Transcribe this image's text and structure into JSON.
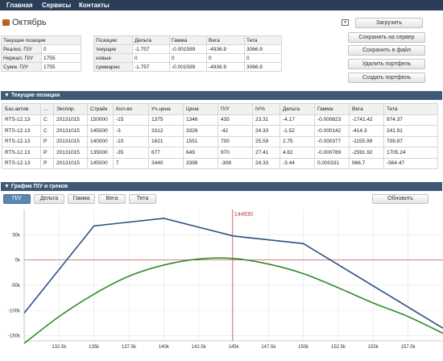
{
  "nav": {
    "items": [
      "Главная",
      "Сервисы",
      "Контакты"
    ]
  },
  "portfolio": {
    "name": "Октябрь"
  },
  "summary": {
    "header": "Текущие позиции",
    "rows": [
      {
        "label": "Реализ. П/У",
        "value": "0"
      },
      {
        "label": "Нереал. П/У",
        "value": "1755"
      },
      {
        "label": "Сумм. П/У",
        "value": "1755"
      }
    ]
  },
  "greeks": {
    "header": [
      "Позиции:",
      "Дельта",
      "Гамма",
      "Вега",
      "Тета"
    ],
    "rows": [
      [
        "текущие",
        "-1.757",
        "-0.001599",
        "-4936.9",
        "3066.9"
      ],
      [
        "новые",
        "0",
        "0",
        "0",
        "0"
      ],
      [
        "суммарно",
        "-1.757",
        "-0.001599",
        "-4936.9",
        "3066.9"
      ]
    ]
  },
  "buttons": {
    "dropdown": "▾",
    "load": "Загрузить",
    "save_server": "Сохранить на сервер",
    "save_file": "Сохранить в файл",
    "delete": "Удалить портфель",
    "create": "Создать портфель",
    "refresh": "Обновить"
  },
  "positions": {
    "title": "▼ Текущие позиции",
    "columns": [
      "Баз.актив",
      "...",
      "Экспир.",
      "Страйк",
      "Кол-во",
      "Уч.цена",
      "Цена",
      "П/У",
      "IV%",
      "Дельта",
      "Гамма",
      "Вега",
      "Тета"
    ],
    "rows": [
      [
        "RTS-12.13",
        "C",
        "20131015",
        "150000",
        "-15",
        "1375",
        "1346",
        "435",
        "23.31",
        "-4.17",
        "-0.000623",
        "-1741.42",
        "974.37"
      ],
      [
        "RTS-12.13",
        "C",
        "20131015",
        "145000",
        "-3",
        "3312",
        "3326",
        "-42",
        "24.33",
        "-1.52",
        "-0.000142",
        "-414.3",
        "241.91"
      ],
      [
        "RTS-12.13",
        "P",
        "20131015",
        "140000",
        "-10",
        "1621",
        "1551",
        "700",
        "25.59",
        "2.75",
        "-0.000377",
        "-1155.99",
        "709.87"
      ],
      [
        "RTS-12.13",
        "P",
        "20131015",
        "135000",
        "-35",
        "677",
        "649",
        "970",
        "27.41",
        "4.62",
        "-0.000789",
        "-2591.92",
        "1705.24"
      ],
      [
        "RTS-12.13",
        "P",
        "20131015",
        "145000",
        "7",
        "3440",
        "3396",
        "-308",
        "24.33",
        "-3.44",
        "0.000331",
        "966.7",
        "-564.47"
      ]
    ]
  },
  "chart_section": {
    "title": "▼ График П/У и греков",
    "tabs": [
      "П/У",
      "Дельта",
      "Гамма",
      "Вега",
      "Тета"
    ],
    "active_tab": "П/У"
  },
  "chart_data": {
    "type": "line",
    "title": "",
    "xlabel": "",
    "ylabel": "",
    "xlim": [
      130000,
      160000
    ],
    "ylim": [
      -160000,
      100000
    ],
    "x_ticks": [
      "132.5k",
      "135k",
      "137.5k",
      "140k",
      "142.5k",
      "145k",
      "147.5k",
      "150k",
      "152.5k",
      "155k",
      "157.5k"
    ],
    "y_ticks": [
      "50k",
      "0k",
      "-50k",
      "-100k",
      "-150k"
    ],
    "marker": {
      "x": 144930,
      "label": "144930",
      "color": "#c0393b"
    },
    "grid": true,
    "series": [
      {
        "color": "#2e4f86",
        "x": [
          130000,
          135000,
          140000,
          145000,
          150000,
          160000
        ],
        "y": [
          -105000,
          67500,
          82500,
          47500,
          32500,
          -135000
        ]
      },
      {
        "color": "#2f8a2a",
        "x": [
          130000,
          132500,
          135000,
          137500,
          140000,
          142500,
          145000,
          147500,
          150000,
          152500,
          155000,
          157500,
          160000
        ],
        "y": [
          -165000,
          -112000,
          -67500,
          -32000,
          -10000,
          2000,
          3000,
          -8000,
          -27000,
          -55000,
          -85000,
          -112000,
          -145000
        ]
      }
    ],
    "colors": {
      "axis": "#c0393b",
      "grid": "#e4e4e4"
    }
  }
}
